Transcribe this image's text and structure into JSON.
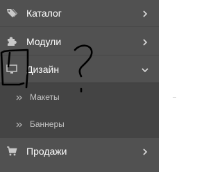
{
  "menu": {
    "items": [
      {
        "label": "Каталог",
        "icon": "tags-icon",
        "chevron": "chevron-right-icon"
      },
      {
        "label": "Модули",
        "icon": "puzzle-icon",
        "chevron": "chevron-right-icon"
      },
      {
        "label": "Дизайн",
        "icon": "desktop-icon",
        "chevron": "chevron-down-icon",
        "expanded": true,
        "children": [
          {
            "label": "Макеты",
            "icon": "double-angle-right-icon"
          },
          {
            "label": "Баннеры",
            "icon": "double-angle-right-icon"
          }
        ]
      },
      {
        "label": "Продажи",
        "icon": "cart-icon",
        "chevron": "chevron-right-icon"
      }
    ]
  },
  "annotation": {
    "marks": "handwritten-question-mark"
  },
  "colors": {
    "sidebar": "#515151",
    "submenu": "#444444",
    "text": "#ffffff",
    "subtext": "#c3c3c3",
    "icon": "#c8c8c8"
  }
}
